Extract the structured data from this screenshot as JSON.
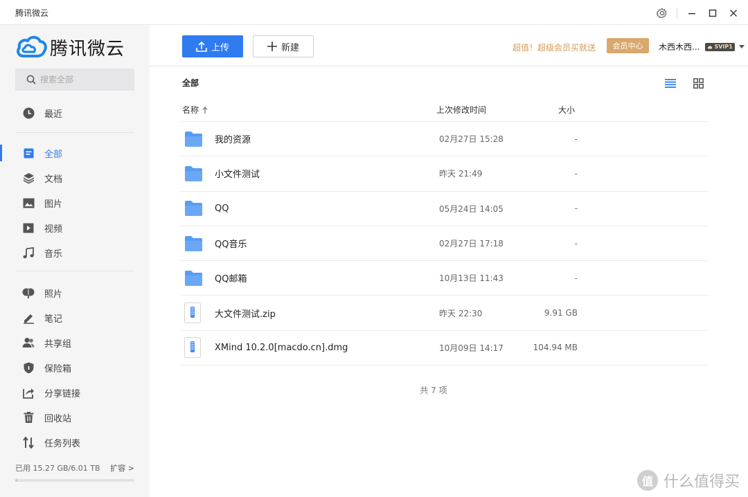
{
  "window": {
    "title": "腾讯微云"
  },
  "icons": {
    "settings": "gear-icon",
    "minimize": "minimize-icon",
    "maximize": "maximize-icon",
    "close": "close-icon"
  },
  "sidebar": {
    "logo_text": "腾讯微云",
    "search_placeholder": "搜索全部",
    "nav_group1": [
      {
        "label": "最近",
        "icon": "clock-icon"
      }
    ],
    "nav_group2": [
      {
        "label": "全部",
        "icon": "document-icon",
        "active": true
      },
      {
        "label": "文档",
        "icon": "layers-icon"
      },
      {
        "label": "图片",
        "icon": "image-icon"
      },
      {
        "label": "视频",
        "icon": "play-icon"
      },
      {
        "label": "音乐",
        "icon": "music-icon"
      }
    ],
    "nav_group3": [
      {
        "label": "照片",
        "icon": "photo-icon"
      },
      {
        "label": "笔记",
        "icon": "pencil-icon"
      },
      {
        "label": "共享组",
        "icon": "group-icon"
      },
      {
        "label": "保险箱",
        "icon": "shield-icon"
      },
      {
        "label": "分享链接",
        "icon": "share-icon"
      },
      {
        "label": "回收站",
        "icon": "trash-icon"
      },
      {
        "label": "任务列表",
        "icon": "transfer-icon"
      }
    ],
    "storage": {
      "text": "已用 15.27 GB/6.01 TB",
      "expand": "扩容 >",
      "used_fraction": 0.0025
    }
  },
  "toolbar": {
    "upload_label": "上传",
    "new_label": "新建",
    "promo": "超值！超级会员买就送",
    "vip_center": "会员中心",
    "username": "木西木西...",
    "vip_badge": "SVIP1"
  },
  "main": {
    "breadcrumb": "全部",
    "columns": {
      "name": "名称",
      "modified": "上次修改时间",
      "size": "大小"
    },
    "files": [
      {
        "name": "我的资源",
        "modified": "02月27日 15:28",
        "size": "-",
        "type": "folder"
      },
      {
        "name": "小文件测试",
        "modified": "昨天 21:49",
        "size": "-",
        "type": "folder"
      },
      {
        "name": "QQ",
        "modified": "05月24日 14:05",
        "size": "-",
        "type": "folder"
      },
      {
        "name": "QQ音乐",
        "modified": "02月27日 17:18",
        "size": "-",
        "type": "folder"
      },
      {
        "name": "QQ邮箱",
        "modified": "10月13日 11:43",
        "size": "-",
        "type": "folder"
      },
      {
        "name": "大文件测试.zip",
        "modified": "昨天 22:30",
        "size": "9.91 GB",
        "type": "zip"
      },
      {
        "name": "XMind 10.2.0[macdo.cn].dmg",
        "modified": "10月09日 14:17",
        "size": "104.94 MB",
        "type": "zip"
      }
    ],
    "total": "共 7 项"
  },
  "watermark": {
    "text": "什么值得买",
    "glyph": "值"
  },
  "colors": {
    "accent": "#2f7bf0",
    "gold": "#d59b56",
    "folder": "#5b9cf2"
  }
}
